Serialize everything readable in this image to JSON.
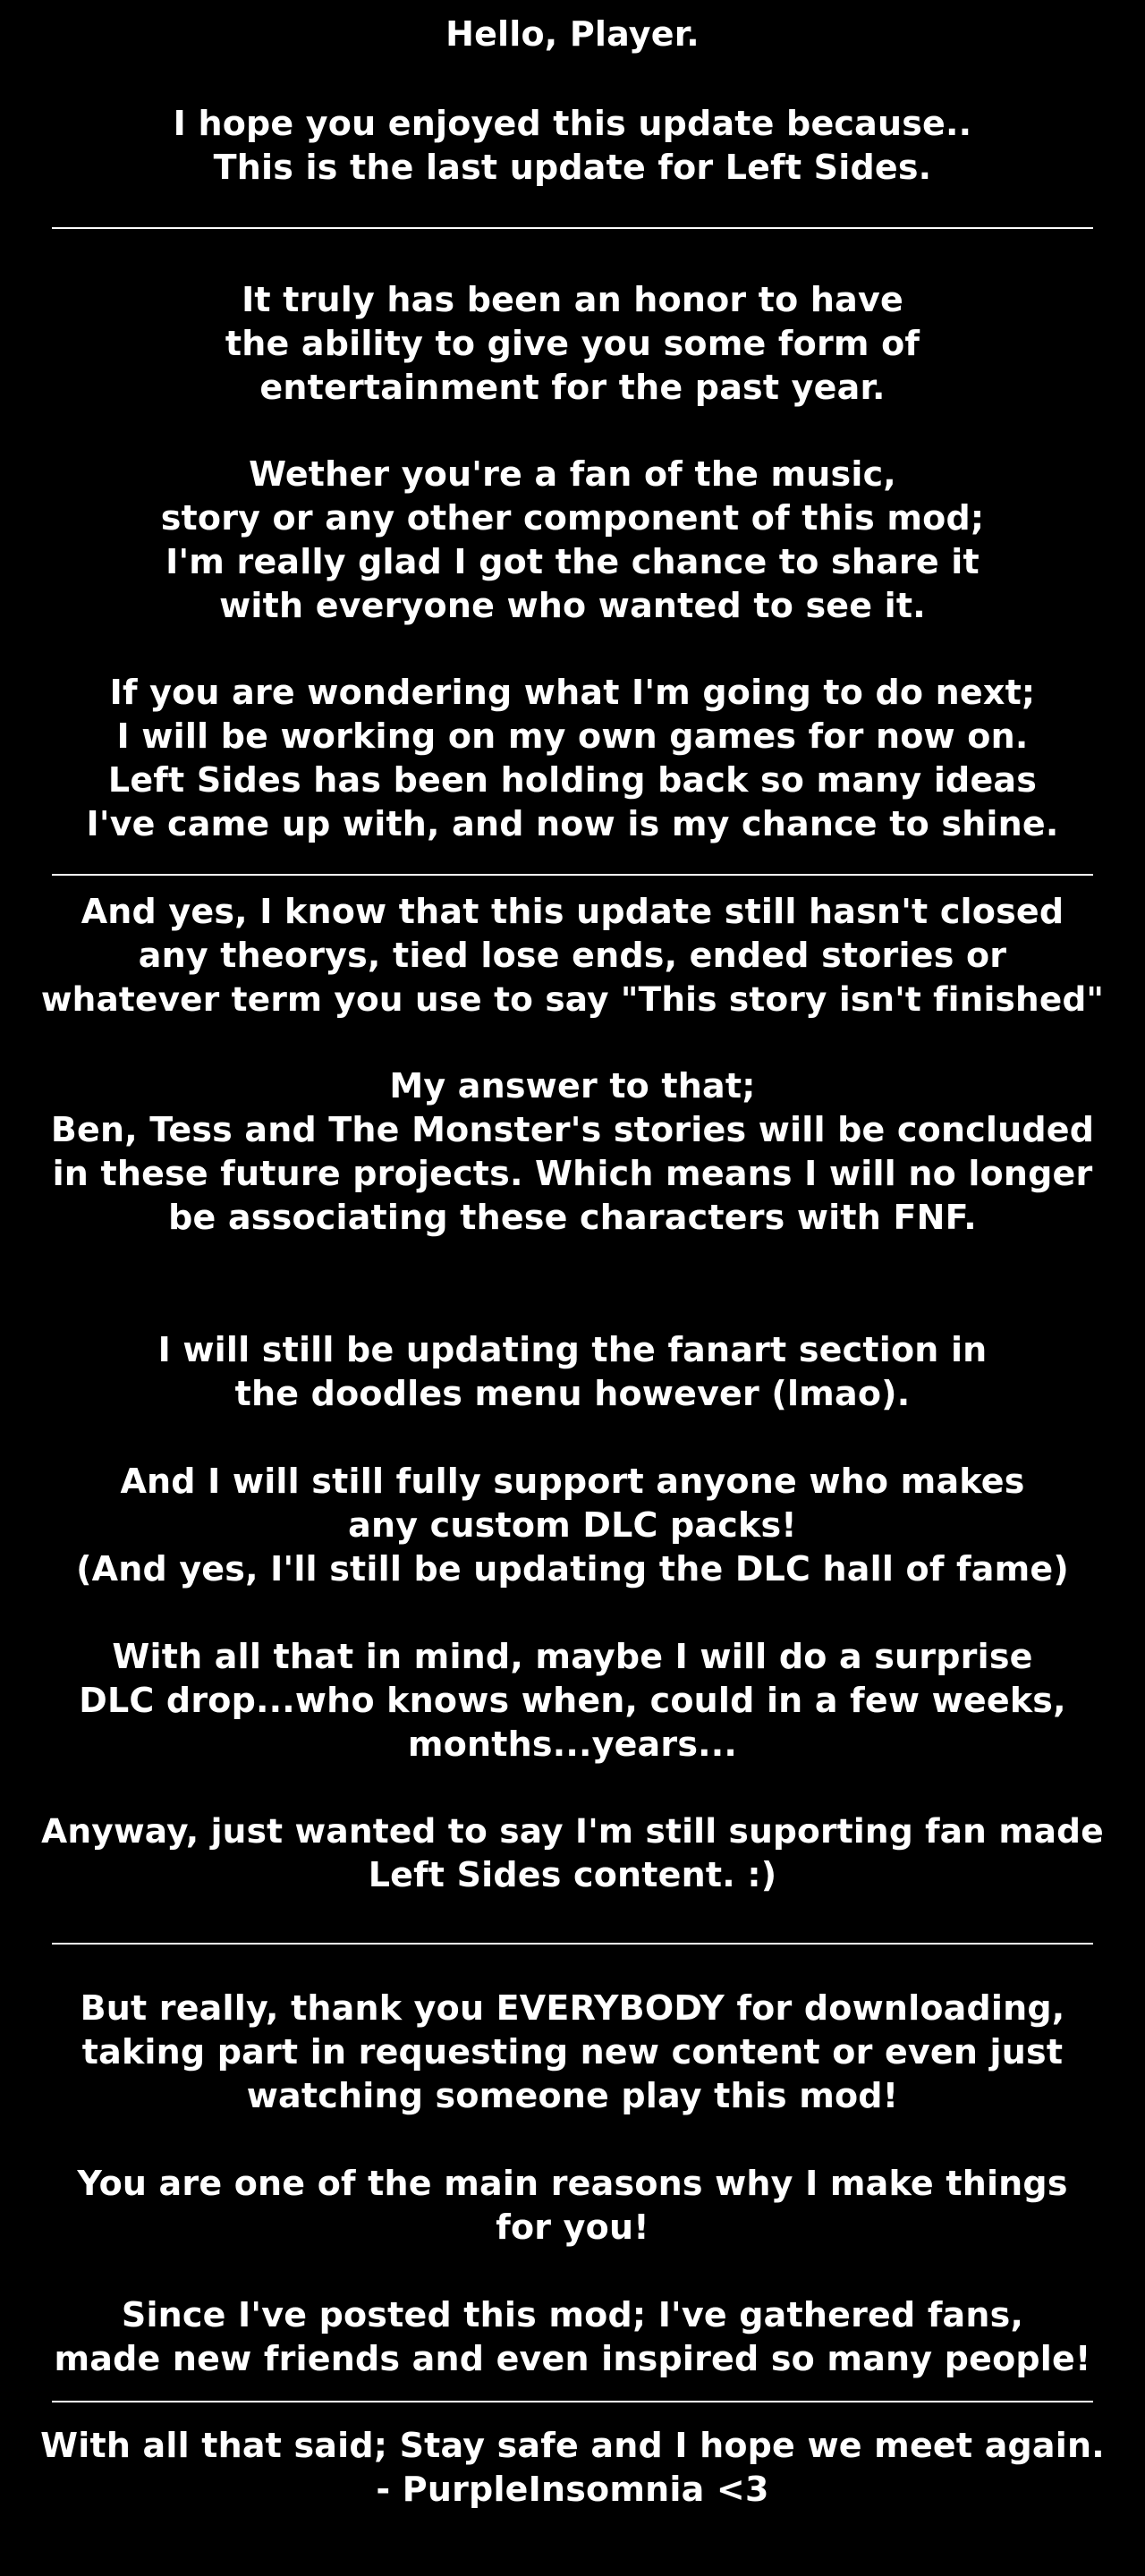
{
  "colors": {
    "background": "#000000",
    "text": "#ffffff",
    "divider": "#ffffff"
  },
  "paragraphs": [
    {
      "lines": [
        "Hello, Player."
      ]
    },
    {
      "lines": [
        "I hope you enjoyed this update because..",
        "This is the last update for Left Sides."
      ]
    },
    {
      "lines": [
        "It truly has been an honor to have",
        "the ability to give you some form of",
        "entertainment for the past year."
      ]
    },
    {
      "lines": [
        "Wether you're a fan of the music,",
        "story or any other component of this mod;",
        "I'm really glad I got the chance to share it",
        "with everyone who wanted to see it."
      ]
    },
    {
      "lines": [
        "If you are wondering what I'm going to do next;",
        "I will be working on my own games for now on.",
        "Left Sides has been holding back so many ideas",
        "I've came up with, and now is my chance to shine."
      ]
    },
    {
      "lines": [
        "And yes, I know that this update still hasn't closed",
        "any theorys, tied lose ends, ended stories or",
        "whatever term you use to say \"This story isn't finished\""
      ]
    },
    {
      "lines": [
        "My answer to that;",
        "Ben, Tess and The Monster's stories will be concluded",
        "in these future projects. Which means I will no longer",
        "be associating these characters with FNF."
      ]
    },
    {
      "lines": [
        "I will still be updating the fanart section in",
        "the doodles menu however (lmao)."
      ]
    },
    {
      "lines": [
        "And I will still fully support anyone who makes",
        "any custom DLC packs!",
        "(And yes, I'll still be updating the DLC hall of fame)"
      ]
    },
    {
      "lines": [
        "With all that in mind, maybe I will do a surprise",
        "DLC drop...who knows when, could in a few weeks,",
        "months...years..."
      ]
    },
    {
      "lines": [
        "Anyway, just wanted to say I'm still suporting fan made",
        "Left Sides content. :)"
      ]
    },
    {
      "lines": [
        "But really, thank you EVERYBODY for downloading,",
        "taking part in requesting new content or even just",
        "watching someone play this mod!"
      ]
    },
    {
      "lines": [
        "You are one of the main reasons why I make things",
        "for you!"
      ]
    },
    {
      "lines": [
        "Since I've posted this mod; I've gathered fans,",
        "made new friends and even inspired so many people!"
      ]
    },
    {
      "lines": [
        "With all that said; Stay safe and I hope we meet again.",
        "- PurpleInsomnia <3"
      ]
    }
  ]
}
